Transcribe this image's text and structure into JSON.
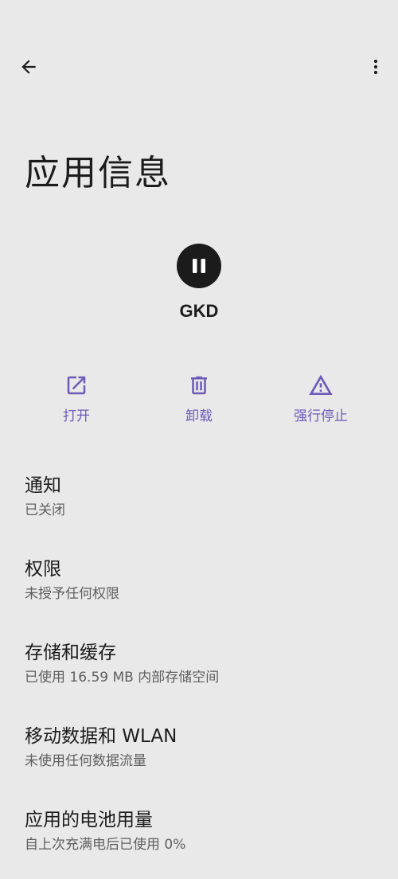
{
  "topbar": {
    "back_icon": "arrow-back-icon",
    "more_icon": "more-vert-icon"
  },
  "page": {
    "title": "应用信息"
  },
  "app": {
    "name": "GKD",
    "icon": "pause-icon"
  },
  "actions": [
    {
      "label": "打开",
      "icon": "open-external-icon"
    },
    {
      "label": "卸载",
      "icon": "trash-icon"
    },
    {
      "label": "强行停止",
      "icon": "warning-icon"
    }
  ],
  "settings": [
    {
      "title": "通知",
      "subtitle": "已关闭"
    },
    {
      "title": "权限",
      "subtitle": "未授予任何权限"
    },
    {
      "title": "存储和缓存",
      "subtitle": "已使用 16.59 MB 内部存储空间"
    },
    {
      "title": "移动数据和 WLAN",
      "subtitle": "未使用任何数据流量"
    },
    {
      "title": "应用的电池用量",
      "subtitle": "自上次充满电后已使用 0%"
    }
  ],
  "colors": {
    "background": "#e9e9e9",
    "accent": "#6e5ab8",
    "text_primary": "#1c1c1c",
    "text_secondary": "#5f5f5f"
  }
}
